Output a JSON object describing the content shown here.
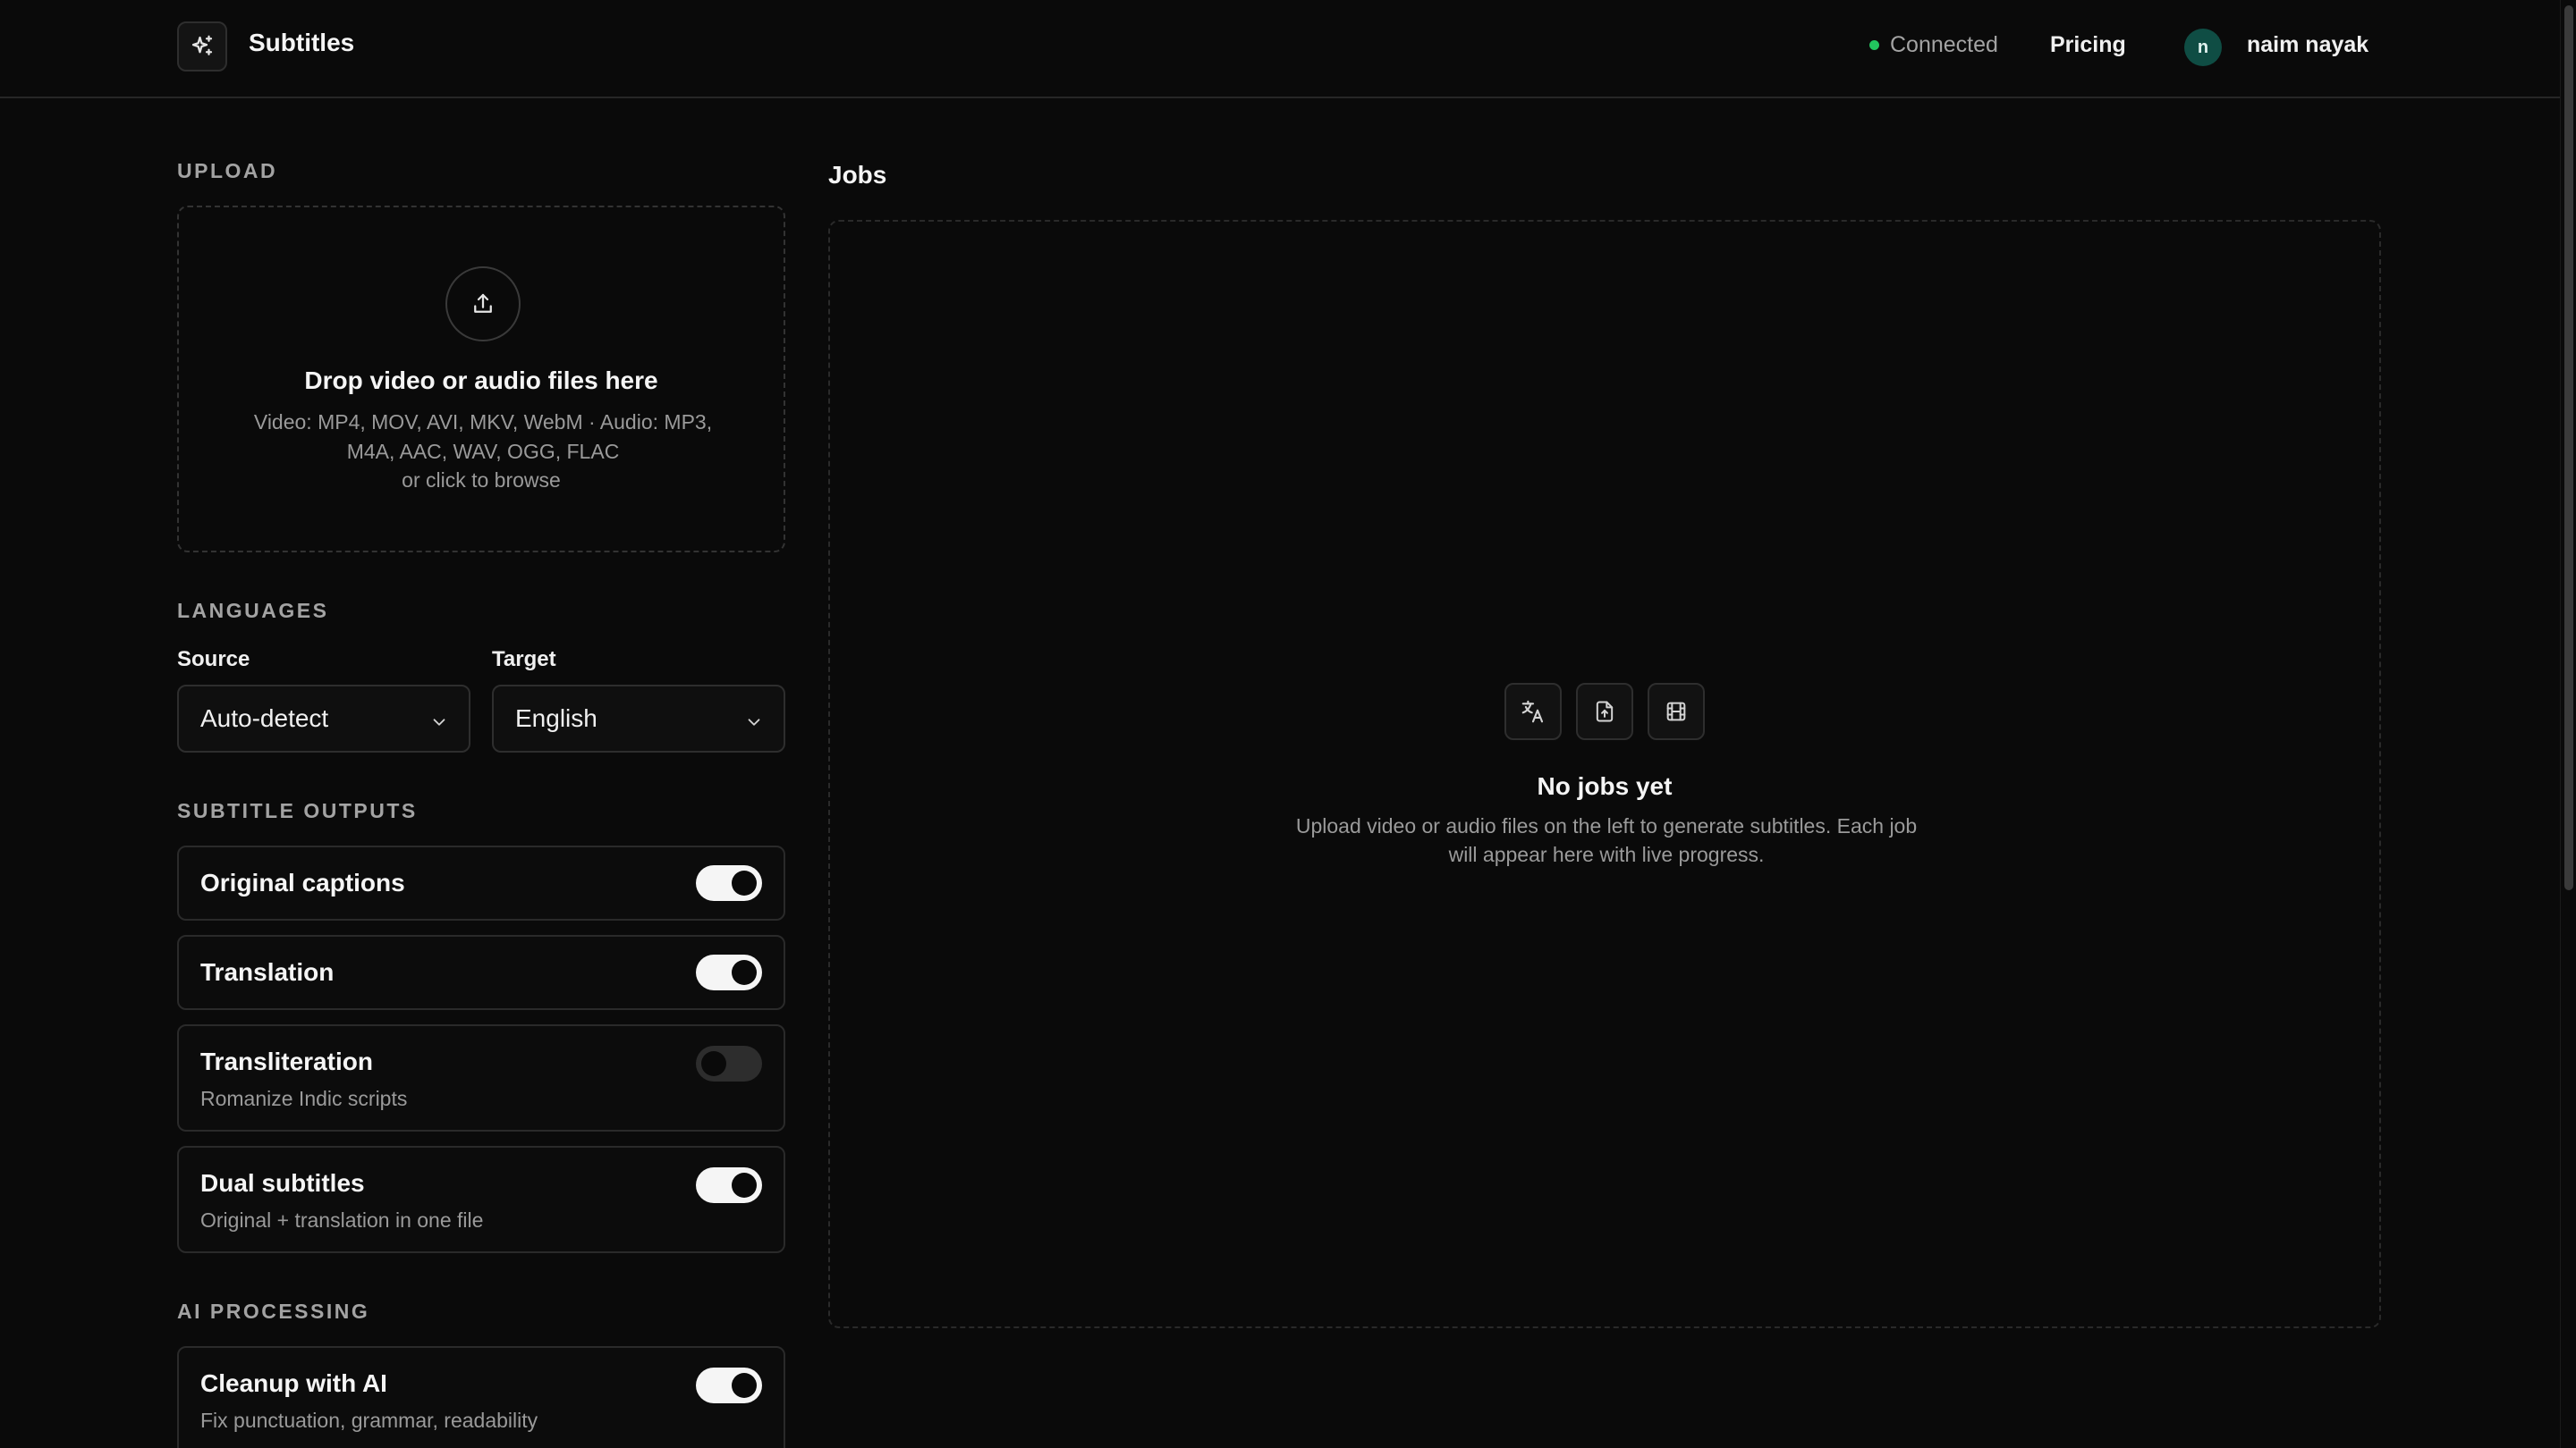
{
  "header": {
    "title": "Subtitles",
    "status": "Connected",
    "pricing_label": "Pricing",
    "user": {
      "initial": "n",
      "name": "naim nayak"
    }
  },
  "upload": {
    "section_label": "UPLOAD",
    "title": "Drop video or audio files here",
    "formats": "Video: MP4, MOV, AVI, MKV, WebM · Audio: MP3, M4A, AAC, WAV, OGG, FLAC",
    "browse": "or click to browse"
  },
  "languages": {
    "section_label": "LANGUAGES",
    "source_label": "Source",
    "source_value": "Auto-detect",
    "target_label": "Target",
    "target_value": "English"
  },
  "outputs": {
    "section_label": "SUBTITLE OUTPUTS",
    "items": [
      {
        "title": "Original captions",
        "desc": "",
        "enabled": true
      },
      {
        "title": "Translation",
        "desc": "",
        "enabled": true
      },
      {
        "title": "Transliteration",
        "desc": "Romanize Indic scripts",
        "enabled": false
      },
      {
        "title": "Dual subtitles",
        "desc": "Original + translation in one file",
        "enabled": true
      }
    ]
  },
  "ai": {
    "section_label": "AI PROCESSING",
    "items": [
      {
        "title": "Cleanup with AI",
        "desc": "Fix punctuation, grammar, readability",
        "enabled": true
      }
    ]
  },
  "jobs": {
    "title": "Jobs",
    "empty_title": "No jobs yet",
    "empty_desc": "Upload video or audio files on the left to generate subtitles. Each job will appear here with live progress.",
    "icons": [
      "translate-icon",
      "file-icon",
      "film-icon"
    ]
  },
  "colors": {
    "background": "#0a0a0a",
    "status_dot": "#22c55e",
    "avatar": "#0f4d44"
  }
}
